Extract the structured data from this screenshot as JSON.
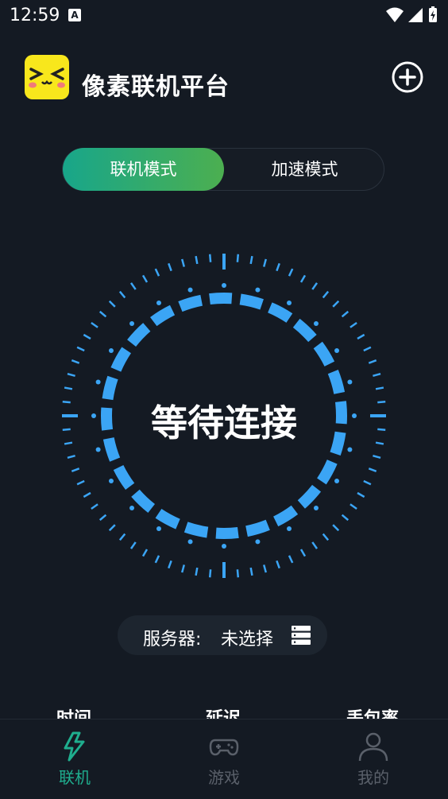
{
  "status_bar": {
    "time": "12:59",
    "notification_icon": "A",
    "icons": [
      "wifi-icon",
      "signal-icon",
      "battery-charging-icon"
    ]
  },
  "header": {
    "app_title": "像素联机平台",
    "logo_icon": "pixel-face-logo",
    "add_icon": "plus-circle-icon"
  },
  "mode_switch": {
    "tabs": [
      {
        "label": "联机模式",
        "active": true
      },
      {
        "label": "加速模式",
        "active": false
      }
    ]
  },
  "dial": {
    "status_text": "等待连接",
    "accent_color": "#3ba5f5"
  },
  "server": {
    "label": "服务器:",
    "value": "未选择",
    "icon": "server-list-icon"
  },
  "stats": {
    "items": [
      {
        "label": "时间"
      },
      {
        "label": "延迟"
      },
      {
        "label": "丢包率"
      }
    ]
  },
  "bottom_nav": {
    "items": [
      {
        "label": "联机",
        "icon": "lightning-icon",
        "active": true
      },
      {
        "label": "游戏",
        "icon": "gamepad-icon",
        "active": false
      },
      {
        "label": "我的",
        "icon": "person-icon",
        "active": false
      }
    ],
    "active_color": "#1fae8e",
    "inactive_color": "#5a606a"
  }
}
